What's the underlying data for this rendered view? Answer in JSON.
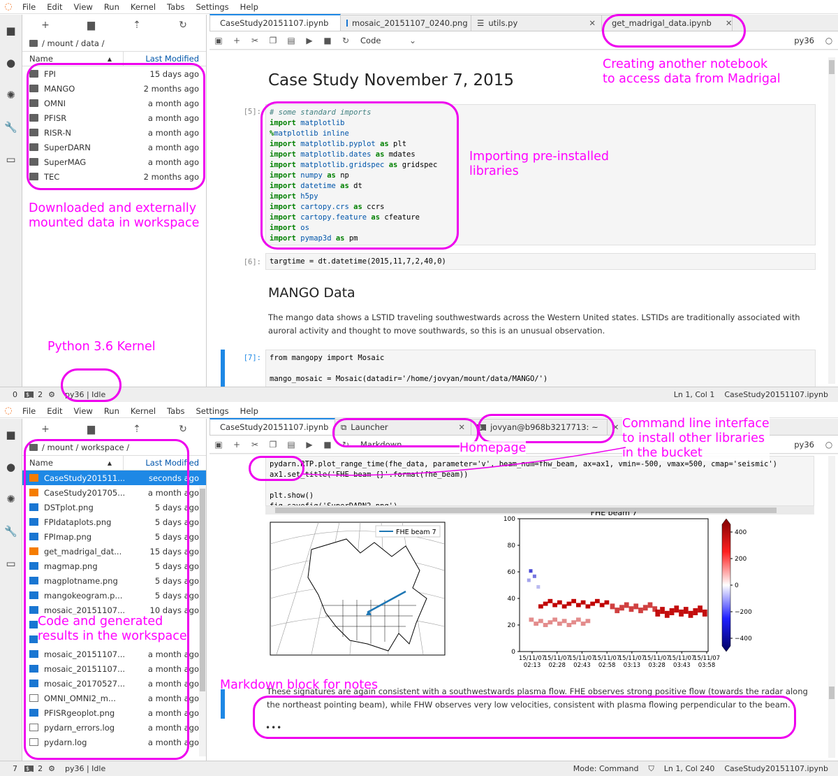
{
  "menu": [
    "File",
    "Edit",
    "View",
    "Run",
    "Kernel",
    "Tabs",
    "Settings",
    "Help"
  ],
  "top": {
    "breadcrumb": "/ mount / data /",
    "col_name": "Name",
    "col_modified": "Last Modified",
    "folders": [
      {
        "name": "FPI",
        "modified": "15 days ago"
      },
      {
        "name": "MANGO",
        "modified": "2 months ago"
      },
      {
        "name": "OMNI",
        "modified": "a month ago"
      },
      {
        "name": "PFISR",
        "modified": "a month ago"
      },
      {
        "name": "RISR-N",
        "modified": "a month ago"
      },
      {
        "name": "SuperDARN",
        "modified": "a month ago"
      },
      {
        "name": "SuperMAG",
        "modified": "a month ago"
      },
      {
        "name": "TEC",
        "modified": "2 months ago"
      }
    ],
    "tabs": [
      "CaseStudy20151107.ipynb",
      "mosaic_20151107_0240.png",
      "utils.py",
      "get_madrigal_data.ipynb"
    ],
    "cell_type": "Code",
    "kernel": "py36",
    "title": "Case Study November 7, 2015",
    "prompt5": "[5]:",
    "imports": [
      {
        "k": "",
        "m": "# some standard imports",
        "a": "",
        "r": "",
        "c": true
      },
      {
        "k": "import",
        "m": "matplotlib",
        "a": "",
        "r": ""
      },
      {
        "k": "%",
        "m": "matplotlib inline",
        "a": "",
        "r": ""
      },
      {
        "k": "import",
        "m": "matplotlib.pyplot",
        "a": "as",
        "r": "plt"
      },
      {
        "k": "import",
        "m": "matplotlib.dates",
        "a": "as",
        "r": "mdates"
      },
      {
        "k": "import",
        "m": "matplotlib.gridspec",
        "a": "as",
        "r": "gridspec"
      },
      {
        "k": "import",
        "m": "numpy",
        "a": "as",
        "r": "np"
      },
      {
        "k": "import",
        "m": "datetime",
        "a": "as",
        "r": "dt"
      },
      {
        "k": "import",
        "m": "h5py",
        "a": "",
        "r": ""
      },
      {
        "k": "import",
        "m": "cartopy.crs",
        "a": "as",
        "r": "ccrs"
      },
      {
        "k": "import",
        "m": "cartopy.feature",
        "a": "as",
        "r": "cfeature"
      },
      {
        "k": "import",
        "m": "os",
        "a": "",
        "r": ""
      },
      {
        "k": "import",
        "m": "pymap3d",
        "a": "as",
        "r": "pm"
      }
    ],
    "prompt6": "[6]:",
    "code6": "targtime = dt.datetime(2015,11,7,2,40,0)",
    "h2": "MANGO Data",
    "mango_text": "The mango data shows a LSTID traveling southwestwards across the Western United states. LSTIDs are traditionally associated with auroral activity and thought to move southwards, so this is an unusual observation.",
    "prompt7": "[7]:",
    "code7a": "from mangopy import Mosaic",
    "code7b": "mango_mosaic = Mosaic(datadir='/home/jovyan/mount/data/MANGO/')",
    "status_left_num": "0",
    "status_num2": "2",
    "status_kernel": "py36 | Idle",
    "status_pos": "Ln 1, Col 1",
    "status_file": "CaseStudy20151107.ipynb"
  },
  "bottom": {
    "breadcrumb": "/ mount / workspace /",
    "col_name": "Name",
    "col_modified": "Last Modified",
    "files": [
      {
        "name": "CaseStudy201511...",
        "modified": "seconds ago",
        "type": "nb",
        "sel": true
      },
      {
        "name": "CaseStudy201705...",
        "modified": "a month ago",
        "type": "nb"
      },
      {
        "name": "DSTplot.png",
        "modified": "5 days ago",
        "type": "img"
      },
      {
        "name": "FPIdataplots.png",
        "modified": "5 days ago",
        "type": "img"
      },
      {
        "name": "FPImap.png",
        "modified": "5 days ago",
        "type": "img"
      },
      {
        "name": "get_madrigal_dat...",
        "modified": "15 days ago",
        "type": "nb"
      },
      {
        "name": "magmap.png",
        "modified": "5 days ago",
        "type": "img"
      },
      {
        "name": "magplotname.png",
        "modified": "5 days ago",
        "type": "img"
      },
      {
        "name": "mangokeogram.p...",
        "modified": "5 days ago",
        "type": "img"
      },
      {
        "name": "mosaic_20151107...",
        "modified": "10 days ago",
        "type": "img"
      },
      {
        "name": "",
        "modified": "",
        "type": "img"
      },
      {
        "name": "",
        "modified": "",
        "type": "img"
      },
      {
        "name": "mosaic_20151107...",
        "modified": "a month ago",
        "type": "img"
      },
      {
        "name": "mosaic_20151107...",
        "modified": "a month ago",
        "type": "img"
      },
      {
        "name": "mosaic_20170527...",
        "modified": "a month ago",
        "type": "img"
      },
      {
        "name": "OMNI_OMNI2_m...",
        "modified": "a month ago",
        "type": "txt"
      },
      {
        "name": "PFISRgeoplot.png",
        "modified": "a month ago",
        "type": "img"
      },
      {
        "name": "pydarn_errors.log",
        "modified": "a month ago",
        "type": "txt"
      },
      {
        "name": "pydarn.log",
        "modified": "a month ago",
        "type": "txt"
      }
    ],
    "tabs": [
      "CaseStudy20151107.ipynb",
      "Launcher",
      "jovyan@b968b3217713: ~"
    ],
    "cell_type": "Markdown",
    "kernel": "py36",
    "code_lines": [
      "pydarn.RTP.plot_range_time(fhe_data, parameter='v', beam_num=fhw_beam, ax=ax1, vmin=-500, vmax=500, cmap='seismic')",
      "ax1.set_title('FHE beam {}'.format(fhe_beam))",
      "",
      "plt.show()",
      "fig.savefig('SuperDARN2.png')"
    ],
    "map_legend": "FHE beam 7",
    "note_text": "These signatures are again consistent with a southwestwards plasma flow. FHE observes strong positive flow (towards the radar along the northeast pointing beam), while FHW observes very low velocities, consistent with plasma flowing perpendicular to the beam.",
    "ellipsis": "•••",
    "status_left_num": "7",
    "status_num2": "2",
    "status_kernel": "py36 | Idle",
    "status_mode": "Mode: Command",
    "status_pos": "Ln 1, Col 240",
    "status_file": "CaseStudy20151107.ipynb"
  },
  "annotations": {
    "a1": "Creating another notebook\nto access data from Madrigal",
    "a2": "Importing pre-installed\nlibraries",
    "a3": "Downloaded and externally\nmounted data in workspace",
    "a4": "Python 3.6 Kernel",
    "a5": "Command line interface\nto install other libraries\nin the bucket",
    "a6": "Homepage",
    "a7": "Code and generated\nresults in the workspace",
    "a8": "Markdown block for notes"
  },
  "chart_data": {
    "type": "heatmap",
    "title": "FHE beam 7",
    "x_ticks": [
      "15/11/07\n02:13",
      "15/11/07\n02:28",
      "15/11/07\n02:43",
      "15/11/07\n02:58",
      "15/11/07\n03:13",
      "15/11/07\n03:28",
      "15/11/07\n03:43",
      "15/11/07\n03:58"
    ],
    "y_ticks": [
      0,
      20,
      40,
      60,
      80,
      100
    ],
    "ylim": [
      0,
      100
    ],
    "colorbar_ticks": [
      400,
      200,
      0,
      -200,
      -400
    ],
    "colorbar_range": [
      -500,
      500
    ],
    "cmap": "seismic",
    "colors": {
      "pos": "#c00000",
      "neg": "#1a1acc"
    },
    "bands": [
      {
        "range_gate_center": 36,
        "value": 450,
        "x_start": 0.1,
        "x_end": 0.48
      },
      {
        "range_gate_center": 33,
        "value": 300,
        "x_start": 0.48,
        "x_end": 0.72
      },
      {
        "range_gate_center": 30,
        "value": 400,
        "x_start": 0.72,
        "x_end": 1.0
      },
      {
        "range_gate_center": 22,
        "value": 150,
        "x_start": 0.05,
        "x_end": 0.38
      }
    ]
  }
}
